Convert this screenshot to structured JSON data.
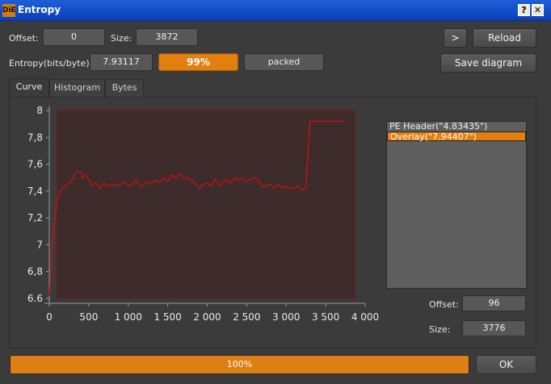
{
  "window": {
    "title": "Entropy",
    "help_label": "?",
    "close_label": "✕",
    "icon_text": "DiE"
  },
  "top": {
    "offset_label": "Offset:",
    "offset_value": "0",
    "size_label": "Size:",
    "size_value": "3872",
    "next_label": ">",
    "reload_label": "Reload",
    "entropy_label": "Entropy(bits/byte):",
    "entropy_value": "7.93117",
    "percent_label": "99%",
    "status_label": "packed",
    "save_label": "Save diagram"
  },
  "tabs": [
    {
      "label": "Curve",
      "active": true
    },
    {
      "label": "Histogram",
      "active": false
    },
    {
      "label": "Bytes",
      "active": false
    }
  ],
  "regions": {
    "items": [
      {
        "label": "PE Header(\"4.83435\")",
        "selected": false
      },
      {
        "label": "Overlay(\"7.94407\")",
        "selected": true
      }
    ],
    "offset_label": "Offset:",
    "offset_value": "96",
    "size_label": "Size:",
    "size_value": "3776"
  },
  "progress": {
    "label": "100%",
    "value": 1.0
  },
  "ok_label": "OK",
  "colors": {
    "accent": "#e27f0e",
    "curve": "#d10f0f",
    "region": "#3e2b2b",
    "region_border": "#7a1a1a"
  },
  "chart_data": {
    "type": "line",
    "xlabel": "",
    "ylabel": "",
    "xlim": [
      0,
      4000
    ],
    "ylim": [
      6.6,
      8.0
    ],
    "xticks": [
      0,
      500,
      1000,
      1500,
      2000,
      2500,
      3000,
      3500,
      4000
    ],
    "xtick_labels": [
      "0",
      "500",
      "1 000",
      "1 500",
      "2 000",
      "2 500",
      "3 000",
      "3 500",
      "4 000"
    ],
    "yticks": [
      6.6,
      6.8,
      7.0,
      7.2,
      7.4,
      7.6,
      7.8,
      8.0
    ],
    "ytick_labels": [
      "6.6",
      "6,8",
      "7",
      "7,2",
      "7,4",
      "7,6",
      "7,8",
      "8"
    ],
    "highlight_region": [
      96,
      3872
    ],
    "x": [
      0,
      50,
      100,
      150,
      200,
      250,
      300,
      350,
      400,
      420,
      460,
      500,
      550,
      580,
      620,
      650,
      700,
      720,
      750,
      800,
      850,
      900,
      950,
      1000,
      1050,
      1100,
      1150,
      1200,
      1250,
      1300,
      1350,
      1400,
      1450,
      1500,
      1550,
      1600,
      1650,
      1700,
      1750,
      1800,
      1850,
      1900,
      1950,
      2000,
      2050,
      2100,
      2150,
      2200,
      2250,
      2300,
      2350,
      2400,
      2450,
      2500,
      2550,
      2600,
      2650,
      2700,
      2750,
      2800,
      2850,
      2900,
      2950,
      3000,
      3050,
      3100,
      3150,
      3200,
      3250,
      3300,
      3350,
      3380,
      3420,
      3440,
      3500,
      3600,
      3700,
      3750
    ],
    "y": [
      6.62,
      7.1,
      7.35,
      7.41,
      7.44,
      7.46,
      7.49,
      7.55,
      7.54,
      7.5,
      7.52,
      7.48,
      7.44,
      7.46,
      7.45,
      7.42,
      7.46,
      7.44,
      7.44,
      7.45,
      7.44,
      7.45,
      7.47,
      7.44,
      7.45,
      7.48,
      7.43,
      7.45,
      7.47,
      7.46,
      7.48,
      7.47,
      7.5,
      7.47,
      7.52,
      7.5,
      7.53,
      7.49,
      7.5,
      7.48,
      7.46,
      7.42,
      7.45,
      7.46,
      7.44,
      7.49,
      7.44,
      7.47,
      7.48,
      7.46,
      7.5,
      7.48,
      7.5,
      7.47,
      7.49,
      7.5,
      7.48,
      7.43,
      7.44,
      7.45,
      7.42,
      7.45,
      7.42,
      7.44,
      7.42,
      7.42,
      7.44,
      7.41,
      7.42,
      7.92,
      7.92,
      7.92,
      7.92,
      7.92,
      7.92,
      7.92,
      7.92,
      7.92
    ]
  }
}
